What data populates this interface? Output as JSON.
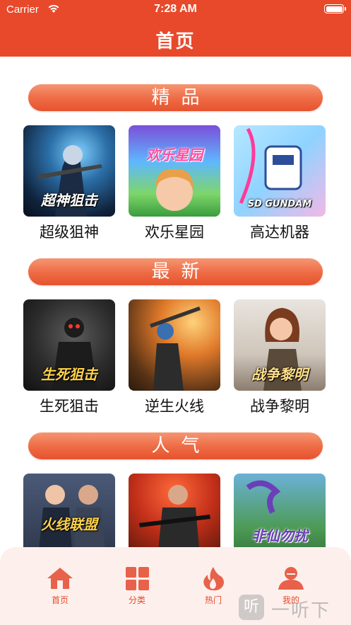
{
  "status_bar": {
    "carrier": "Carrier",
    "time": "7:28 AM"
  },
  "header": {
    "title": "首页"
  },
  "sections": [
    {
      "title": "精品",
      "games": [
        {
          "name": "超级狙神",
          "art_text": "超神狙击"
        },
        {
          "name": "欢乐星园",
          "art_text": "欢乐星园"
        },
        {
          "name": "高达机器",
          "art_text": "SD GUNDAM"
        }
      ]
    },
    {
      "title": "最新",
      "games": [
        {
          "name": "生死狙击",
          "art_text": "生死狙击"
        },
        {
          "name": "逆生火线",
          "art_text": ""
        },
        {
          "name": "战争黎明",
          "art_text": "战争黎明"
        }
      ]
    },
    {
      "title": "人气",
      "games": [
        {
          "name": "",
          "art_text": "火线联盟"
        },
        {
          "name": "",
          "art_text": ""
        },
        {
          "name": "",
          "art_text": "非仙勿扰"
        }
      ]
    }
  ],
  "tabbar": {
    "items": [
      {
        "label": "首页",
        "icon": "home-icon"
      },
      {
        "label": "分类",
        "icon": "category-grid-icon"
      },
      {
        "label": "热门",
        "icon": "flame-icon"
      },
      {
        "label": "我的",
        "icon": "user-icon"
      }
    ]
  },
  "watermark": {
    "logo": "听",
    "text": "一听下载"
  },
  "colors": {
    "primary": "#e8492b",
    "pill_light": "#f59573",
    "tabbar_bg": "#fdf0ec"
  }
}
